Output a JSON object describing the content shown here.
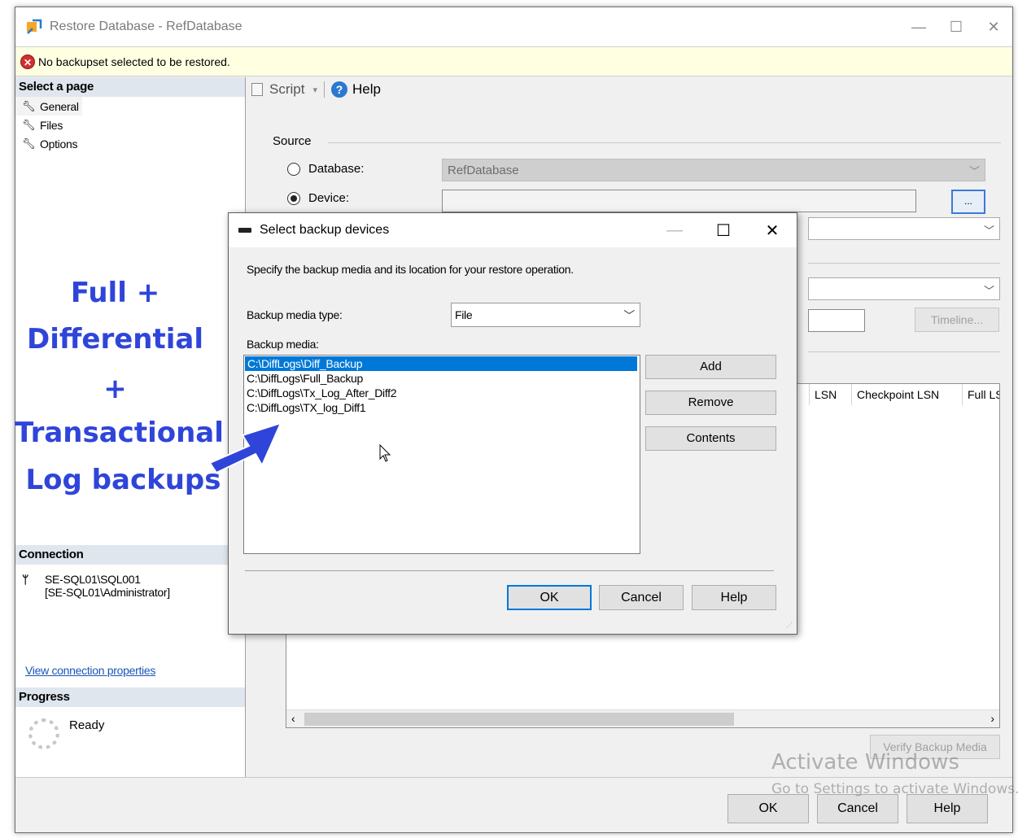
{
  "window": {
    "title": "Restore Database - RefDatabase",
    "controls": [
      "—",
      "☐",
      "✕"
    ]
  },
  "infobar": {
    "message": "No backupset selected to be restored.",
    "icon": "error-icon"
  },
  "left": {
    "select_page_header": "Select a page",
    "pages": [
      "General",
      "Files",
      "Options"
    ],
    "connection_header": "Connection",
    "connection_server": "SE-SQL01\\SQL001",
    "connection_user": "[SE-SQL01\\Administrator]",
    "view_connection_link": "View connection properties",
    "progress_header": "Progress",
    "progress_status": "Ready"
  },
  "annotation": {
    "lines": [
      "Full +",
      "Differential",
      "+",
      "Transactional",
      "Log backups"
    ],
    "color": "#2f45d9"
  },
  "toolbar": {
    "script_label": "Script",
    "help_label": "Help"
  },
  "source": {
    "legend": "Source",
    "database_label": "Database:",
    "database_value": "RefDatabase",
    "device_label": "Device:",
    "selected": "device"
  },
  "timeline_label": "Timeline...",
  "grid": {
    "headers": [
      "LSN",
      "Checkpoint LSN",
      "Full LS"
    ]
  },
  "verify_label": "Verify Backup Media",
  "bottom_buttons": {
    "ok": "OK",
    "cancel": "Cancel",
    "help": "Help"
  },
  "watermark": {
    "line1": "Activate Windows",
    "line2": "Go to Settings to activate Windows."
  },
  "dialog": {
    "title": "Select backup devices",
    "instruction": "Specify the backup media and its location for your restore operation.",
    "media_type_label": "Backup media type:",
    "media_type_value": "File",
    "media_label": "Backup media:",
    "media_items": [
      "C:\\DiffLogs\\Diff_Backup",
      "C:\\DiffLogs\\Full_Backup",
      "C:\\DiffLogs\\Tx_Log_After_Diff2",
      "C:\\DiffLogs\\TX_log_Diff1"
    ],
    "selected_index": 0,
    "add_label": "Add",
    "remove_label": "Remove",
    "contents_label": "Contents",
    "ok_label": "OK",
    "cancel_label": "Cancel",
    "help_label": "Help",
    "controls": [
      "—",
      "☐",
      "✕"
    ]
  }
}
